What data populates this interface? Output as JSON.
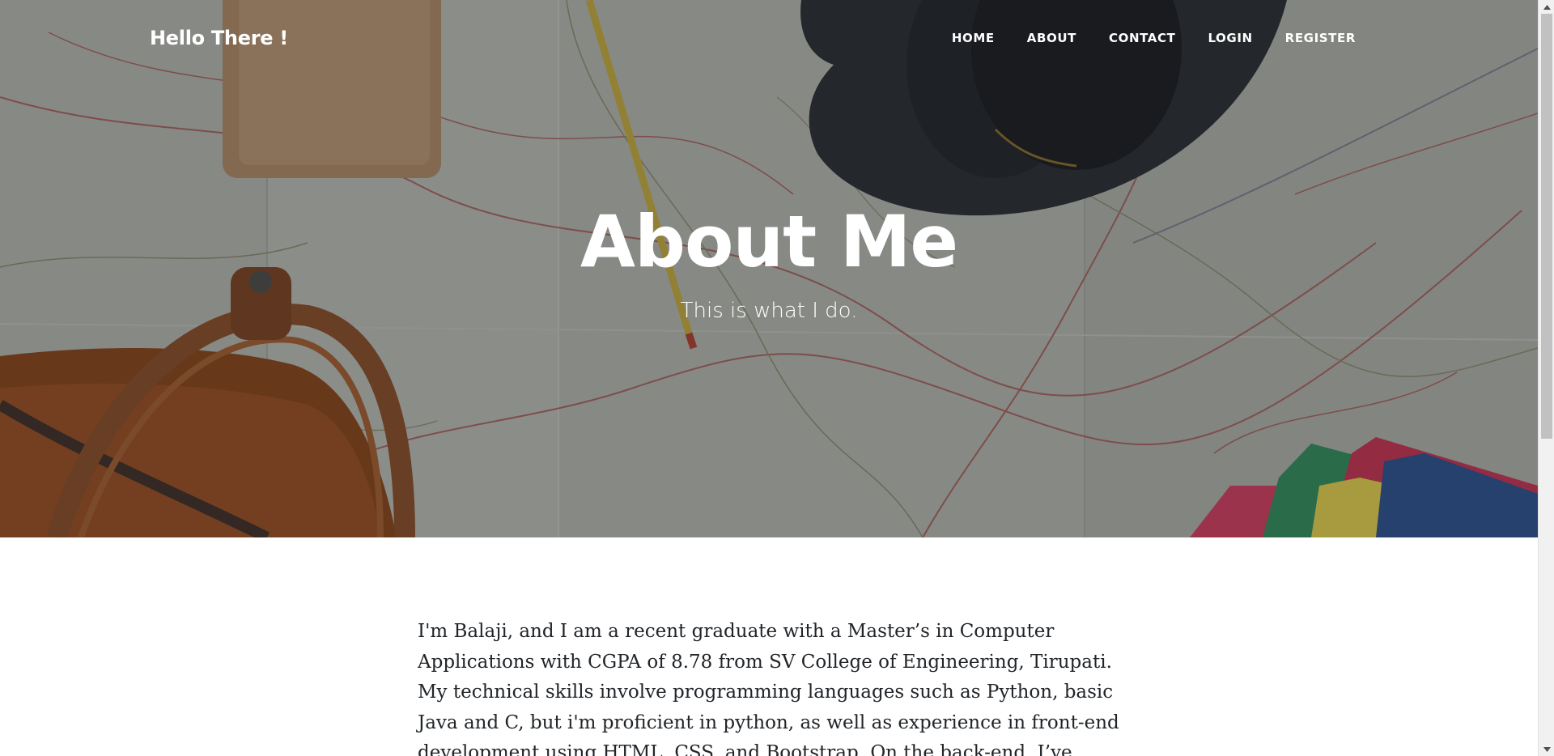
{
  "navbar": {
    "brand": "Hello There !",
    "items": [
      {
        "label": "Home"
      },
      {
        "label": "About"
      },
      {
        "label": "Contact"
      },
      {
        "label": "Login"
      },
      {
        "label": "Register"
      }
    ]
  },
  "hero": {
    "title": "About Me",
    "subtitle": "This is what I do."
  },
  "content": {
    "paragraph": "I'm Balaji, and I am a recent graduate with a Master’s in Computer Applications with CGPA of 8.78 from SV College of Engineering, Tirupati. My technical skills involve programming languages such as Python, basic Java and C, but i'm proficient in python, as well as experience in front-end development using HTML, CSS, and Bootstrap. On the back-end, I’ve"
  },
  "colors": {
    "hero_overlay": "#212529",
    "text": "#212529",
    "nav_text": "#ffffff"
  },
  "icons": {
    "scroll_up": "triangle-up-icon",
    "scroll_down": "triangle-down-icon"
  }
}
